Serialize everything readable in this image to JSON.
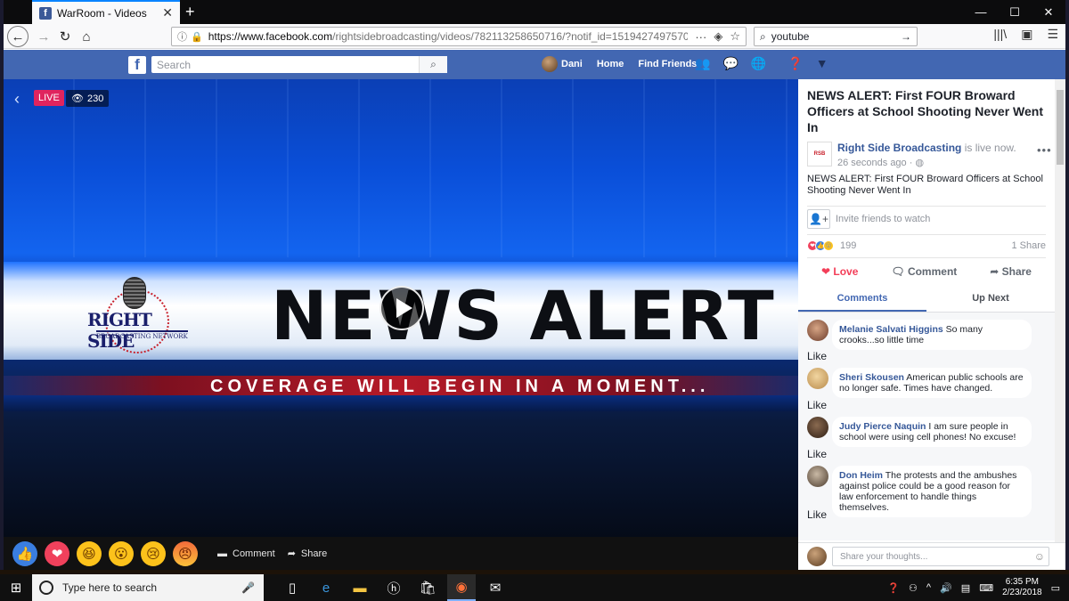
{
  "browser": {
    "tab_title": "WarRoom - Videos",
    "url_domain": "https://www.facebook.com",
    "url_path": "/rightsidebroadcasting/videos/782113258650716/?notif_id=15194274975707268...",
    "search_value": "youtube"
  },
  "facebook": {
    "search_placeholder": "Search",
    "user_name": "Dani",
    "nav_home": "Home",
    "nav_find_friends": "Find Friends"
  },
  "video": {
    "live_label": "LIVE",
    "viewer_count": "230",
    "headline": "NEWS ALERT",
    "subline": "COVERAGE WILL BEGIN IN A MOMENT...",
    "logo_right": "RIGHT",
    "logo_side": "SIDE",
    "logo_network": "BROADCASTING NETWORK",
    "comment_label": "Comment",
    "share_label": "Share"
  },
  "post": {
    "title": "NEWS ALERT: First FOUR Broward Officers at School Shooting Never Went In",
    "author": "Right Side Broadcasting",
    "live_status": " is live now.",
    "timestamp": "26 seconds ago · ",
    "description": "NEWS ALERT: First FOUR Broward Officers at School Shooting Never Went In",
    "invite_label": "Invite friends to watch",
    "reaction_count": "199",
    "share_count": "1 Share",
    "action_love": "Love",
    "action_comment": "Comment",
    "action_share": "Share",
    "tab_comments": "Comments",
    "tab_up_next": "Up Next",
    "composer_placeholder": "Share your thoughts..."
  },
  "comments": [
    {
      "name": "Melanie Salvati Higgins",
      "text": " So many crooks...so little time",
      "like": "Like"
    },
    {
      "name": "Sheri Skousen",
      "text": " American public schools are no longer safe. Times have changed.",
      "like": "Like"
    },
    {
      "name": "Judy Pierce Naquin",
      "text": " I am sure people in school were using cell phones! No excuse!",
      "like": "Like"
    },
    {
      "name": "Don Heim",
      "text": " The protests and the ambushes against police could be a good reason for law enforcement to handle things themselves.",
      "like": "Like"
    }
  ],
  "taskbar": {
    "search_placeholder": "Type here to search",
    "time": "6:35 PM",
    "date": "2/23/2018"
  },
  "colors": {
    "facebook_blue": "#4267b2",
    "live_red": "#e0245e",
    "link_blue": "#365899"
  }
}
